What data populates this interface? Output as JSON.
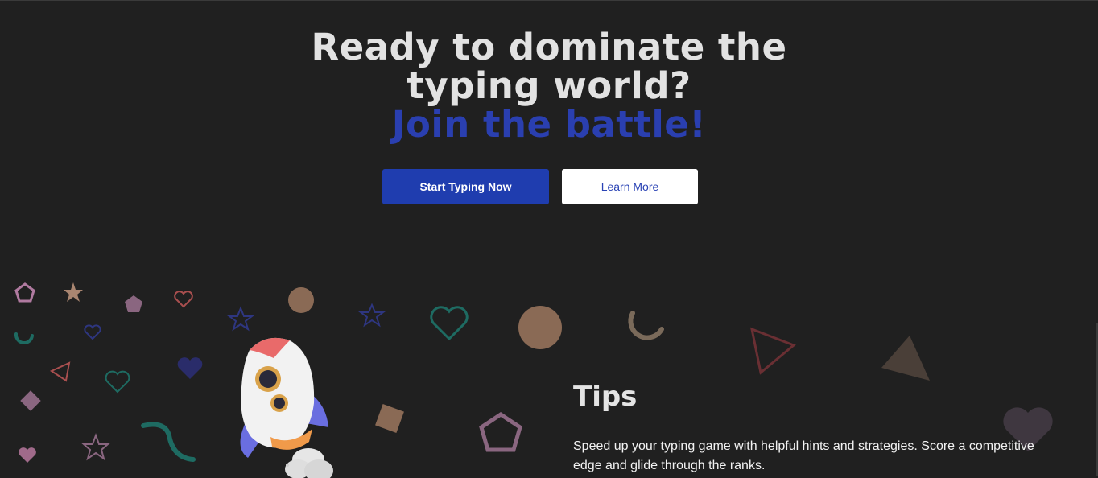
{
  "hero": {
    "line1": "Ready to dominate the",
    "line2": "typing world?",
    "accent": "Join the battle!"
  },
  "buttons": {
    "primary": "Start Typing Now",
    "secondary": "Learn More"
  },
  "tips": {
    "title": "Tips",
    "body": "Speed up your typing game with helpful hints and strategies. Score a competitive edge and glide through the ranks."
  },
  "colors": {
    "background": "#202020",
    "accent": "#2a3fb0",
    "primary_button": "#1f3daf"
  },
  "icons": [
    "rocket-illustration",
    "pentagon",
    "star",
    "heart",
    "circle",
    "triangle",
    "diamond",
    "squiggle"
  ]
}
